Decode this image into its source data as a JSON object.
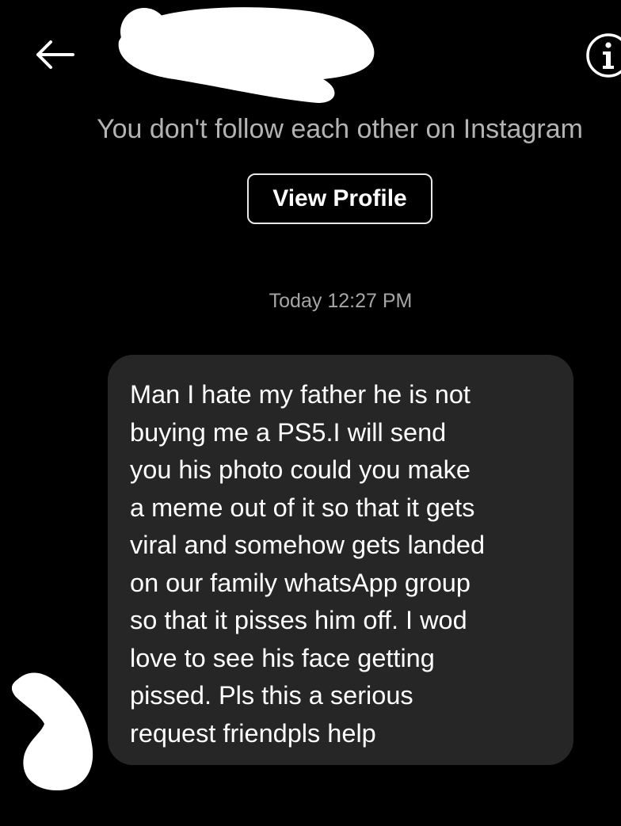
{
  "header": {
    "back_icon": "arrow-left-icon",
    "info_icon": "info-circle-icon"
  },
  "notice": {
    "follow_status": "You don't follow each other on Instagram",
    "view_profile_label": "View Profile"
  },
  "thread": {
    "timestamp": "Today 12:27 PM",
    "messages": [
      {
        "text": "Man I hate my father he is not\nbuying me a PS5.I will send\nyou his photo could you make\na meme out of it so that it gets\nviral and somehow gets landed\non our family whatsApp group\nso that it pisses him off. I wod\nlove to see his face getting\npissed. Pls this a serious\nrequest friendpls help"
      }
    ]
  },
  "colors": {
    "background": "#000000",
    "bubble": "#262626",
    "muted_text": "#b3b3b3",
    "button_border": "#e8e8e8"
  }
}
